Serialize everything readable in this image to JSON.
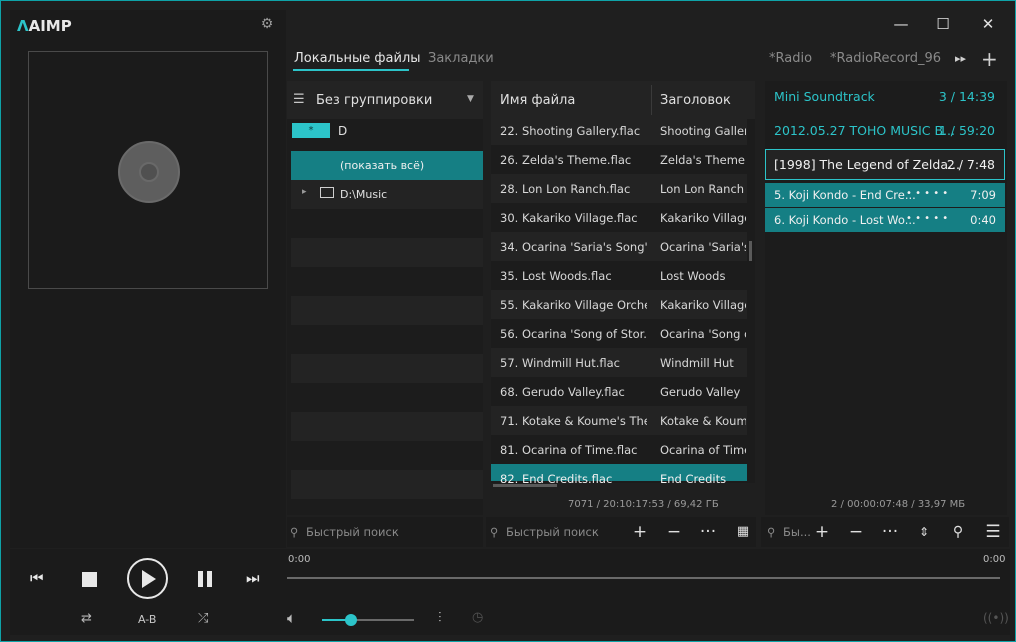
{
  "app": {
    "logo": "AIMP"
  },
  "tabs": [
    {
      "label": "Локальные файлы"
    },
    {
      "label": "Закладки"
    },
    {
      "label": "*Radio"
    },
    {
      "label": "*RadioRecord_96"
    }
  ],
  "group_panel": {
    "header": "Без группировки",
    "filter_badge": "*",
    "filter_label": "D",
    "show_all": "(показать всё)",
    "folder": "D:\\Music"
  },
  "file_list": {
    "col_name": "Имя файла",
    "col_title": "Заголовок",
    "rows": [
      {
        "name": "22. Shooting Gallery.flac",
        "title": "Shooting Gallery"
      },
      {
        "name": "26. Zelda's Theme.flac",
        "title": "Zelda's Theme"
      },
      {
        "name": "28. Lon Lon Ranch.flac",
        "title": "Lon Lon Ranch"
      },
      {
        "name": "30. Kakariko Village.flac",
        "title": "Kakariko Village"
      },
      {
        "name": "34. Ocarina 'Saria's Song'....",
        "title": "Ocarina 'Saria's S"
      },
      {
        "name": "35. Lost Woods.flac",
        "title": "Lost Woods"
      },
      {
        "name": "55. Kakariko Village Orche...",
        "title": "Kakariko Village"
      },
      {
        "name": "56. Ocarina 'Song of Stor...",
        "title": "Ocarina 'Song of"
      },
      {
        "name": "57. Windmill Hut.flac",
        "title": "Windmill Hut"
      },
      {
        "name": "68. Gerudo Valley.flac",
        "title": "Gerudo Valley"
      },
      {
        "name": "71. Kotake & Koume's The...",
        "title": "Kotake & Koume"
      },
      {
        "name": "81. Ocarina of Time.flac",
        "title": "Ocarina of Time"
      },
      {
        "name": "82. End Credits.flac",
        "title": "End Credits"
      }
    ],
    "status": "7071 / 20:10:17:53 / 69,42 ГБ",
    "search_placeholder": "Быстрый поиск"
  },
  "playlist": {
    "groups": [
      {
        "name": "Mini Soundtrack",
        "info": "3 / 14:39"
      },
      {
        "name": "2012.05.27 TOHO MUSIC B...",
        "info": "1 / 59:20"
      },
      {
        "name": "[1998] The Legend of Zelda...",
        "info": "2 / 7:48"
      }
    ],
    "tracks": [
      {
        "name": "5. Koji Kondo - End Cre...",
        "rating": "• • • • •",
        "time": "7:09"
      },
      {
        "name": "6. Koji Kondo - Lost Wo...",
        "rating": "• • • • •",
        "time": "0:40"
      }
    ],
    "status": "2 / 00:00:07:48 / 33,97 МБ",
    "search_placeholder": "Бы..."
  },
  "group_search_placeholder": "Быстрый поиск",
  "player": {
    "time_elapsed": "0:00",
    "time_total": "0:00",
    "ab_label": "A-B",
    "volume": 0.32
  },
  "colors": {
    "accent": "#2cc4c9",
    "selection": "#157f84"
  }
}
